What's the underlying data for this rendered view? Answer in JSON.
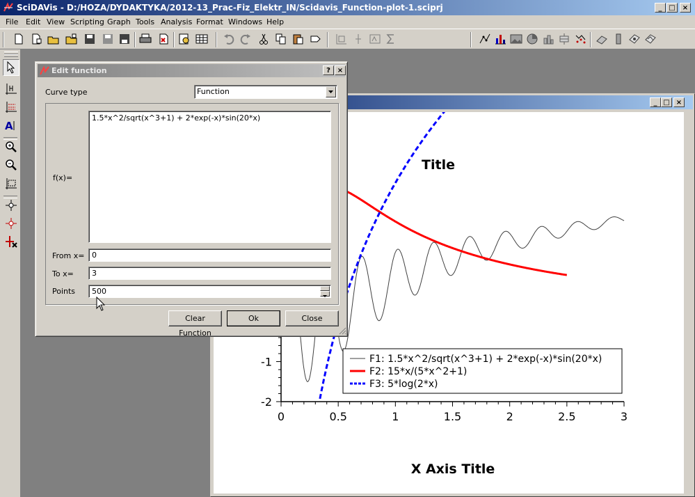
{
  "window": {
    "title": "SciDAVis - D:/HOZA/DYDAKTYKA/2012-13_Prac-Fiz_Elektr_IN/Scidavis_Function-plot-1.sciprj",
    "caption_buttons": [
      "_",
      "□",
      "×"
    ]
  },
  "menubar": {
    "items": [
      "File",
      "Edit",
      "View",
      "Scripting",
      "Graph",
      "Tools",
      "Analysis",
      "Format",
      "Windows",
      "Help"
    ]
  },
  "toolbar": {
    "icons": [
      "new-project-icon",
      "new-folder-icon",
      "open-icon",
      "open-template-icon",
      "save-icon",
      "save-as-icon",
      "print-icon",
      "export-pdf-icon",
      "export-icon",
      "preview-icon",
      "table-icon",
      "undo-icon",
      "redo-icon",
      "cut-icon",
      "copy-icon",
      "paste-icon",
      "clear-icon",
      "add-column-icon",
      "add-layer-icon",
      "function-icon",
      "sum-icon",
      "line-plot-icon",
      "bar-plot-icon",
      "image-plot-icon",
      "pie-plot-icon",
      "3d-bar-icon",
      "box-plot-icon",
      "scatter-icon",
      "3d-wireframe-icon",
      "3d-ribbon-icon",
      "3d-scatter-icon",
      "3d-trajectory-icon"
    ]
  },
  "left_tools": {
    "icons": [
      "pointer-icon",
      "data-reader-icon",
      "select-range-icon",
      "add-text-icon",
      "zoom-in-icon",
      "zoom-out-icon",
      "rescale-icon",
      "move-points-icon",
      "delete-points-icon",
      "remove-bad-points-icon"
    ]
  },
  "dialog": {
    "title": "Edit function",
    "help_button": "?",
    "close_button": "×",
    "curve_type_label": "Curve type",
    "curve_type_value": "Function",
    "fx_label": "f(x)=",
    "fx_value": "1.5*x^2/sqrt(x^3+1) + 2*exp(-x)*sin(20*x)",
    "from_label": "From x=",
    "from_value": "0",
    "to_label": "To x=",
    "to_value": "3",
    "points_label": "Points",
    "points_value": "500",
    "clear_button": "Clear Function",
    "ok_button": "Ok",
    "close_dialog_button": "Close"
  },
  "graph_window": {
    "caption_buttons": [
      "_",
      "□",
      "×"
    ]
  },
  "chart_data": {
    "type": "line",
    "title": "Title",
    "xlabel": "X Axis Title",
    "ylabel": "",
    "xlim": [
      0,
      3
    ],
    "ylim": [
      -2,
      4.1
    ],
    "x_ticks": [
      "0",
      "0.5",
      "1",
      "1.5",
      "2",
      "2.5",
      "3"
    ],
    "y_ticks": [
      "-1",
      "-2"
    ],
    "legend_position": "bottom-right",
    "series": [
      {
        "name": "F1: 1.5*x^2/sqrt(x^3+1) + 2*exp(-x)*sin(20*x)",
        "formula": "1.5*x^2/sqrt(x^3+1) + 2*exp(-x)*sin(20*x)",
        "x_range": [
          0,
          3
        ],
        "color": "#404040",
        "style": "solid"
      },
      {
        "name": "F2: 15*x/(5*x^2+1)",
        "formula": "15*x/(5*x^2+1)",
        "x_range": [
          0,
          2.5
        ],
        "color": "#ff0000",
        "style": "solid"
      },
      {
        "name": "F3: 5*log(2*x)",
        "formula": "5*log(2*x)",
        "x_range": [
          0,
          3
        ],
        "color": "#0000ff",
        "style": "dashed"
      }
    ]
  }
}
